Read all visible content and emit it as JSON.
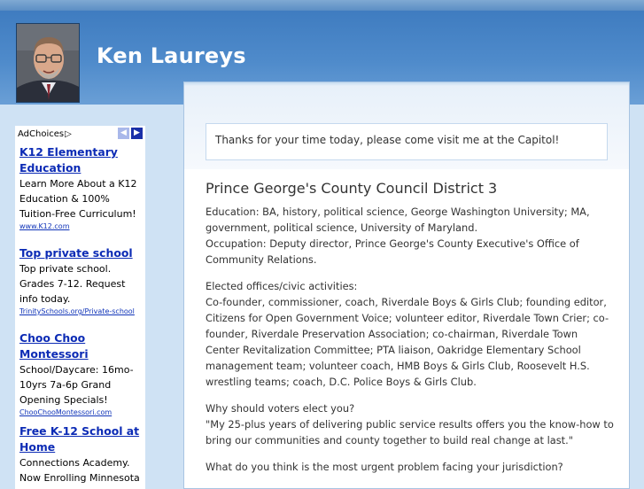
{
  "header": {
    "site_title": "Ken Laureys"
  },
  "notice": {
    "text": "Thanks for your time today, please come visit me at the Capitol!"
  },
  "article": {
    "title": "Prince George's County Council District 3",
    "paragraphs": [
      "Education: BA, history, political science, George Washington University; MA, government, political science, University of Maryland.\nOccupation: Deputy director, Prince George's County Executive's Office of Community Relations.",
      "Elected offices/civic activities:\nCo-founder, commissioner, coach, Riverdale Boys & Girls Club; founding editor, Citizens for Open Government Voice; volunteer editor, Riverdale Town Crier; co-founder, Riverdale Preservation Association; co-chairman, Riverdale Town Center Revitalization Committee; PTA liaison, Oakridge Elementary School management team; volunteer coach, HMB Boys & Girls Club, Roosevelt H.S. wrestling teams; coach, D.C. Police Boys & Girls Club.",
      "Why should voters elect you?\n\"My 25-plus years of delivering public service results offers you the know-how to bring our communities and county together to build real change at last.\"",
      "What do you think is the most urgent problem facing your jurisdiction?"
    ]
  },
  "ads": {
    "adchoices_label": "AdChoices",
    "adchoices_icon": "▷",
    "prev_icon": "◀",
    "next_icon": "▶",
    "items": [
      {
        "title": "K12 Elementary Education",
        "desc": "Learn More About a K12 Education & 100% Tuition-Free Curriculum!",
        "url": "www.K12.com"
      },
      {
        "title": "Top private school",
        "desc": "Top private school. Grades 7-12. Request info today.",
        "url": "TrinitySchools.org/Private-school"
      },
      {
        "title": "Choo Choo Montessori",
        "desc": "School/Daycare: 16mo-10yrs 7a-6p Grand Opening Specials!",
        "url": "ChooChooMontessori.com"
      },
      {
        "title": "Free K-12 School at Home",
        "desc": "Connections Academy. Now Enrolling Minnesota",
        "url": ""
      }
    ]
  }
}
